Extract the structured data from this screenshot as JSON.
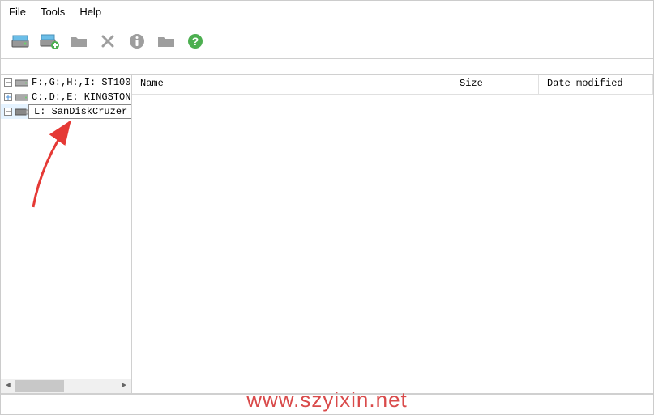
{
  "menubar": {
    "file": "File",
    "tools": "Tools",
    "help": "Help"
  },
  "drives": [
    {
      "label": "F:,G:,H:,I: ST100"
    },
    {
      "label": "C:,D:,E: KINGSTON"
    },
    {
      "label": "L: SanDiskCruzer"
    }
  ],
  "tooltip": "L: SanDiskCruzer Blade (USB-Disk)",
  "file_headers": {
    "name": "Name",
    "size": "Size",
    "date": "Date modified"
  },
  "watermark": "www.szyixin.net"
}
